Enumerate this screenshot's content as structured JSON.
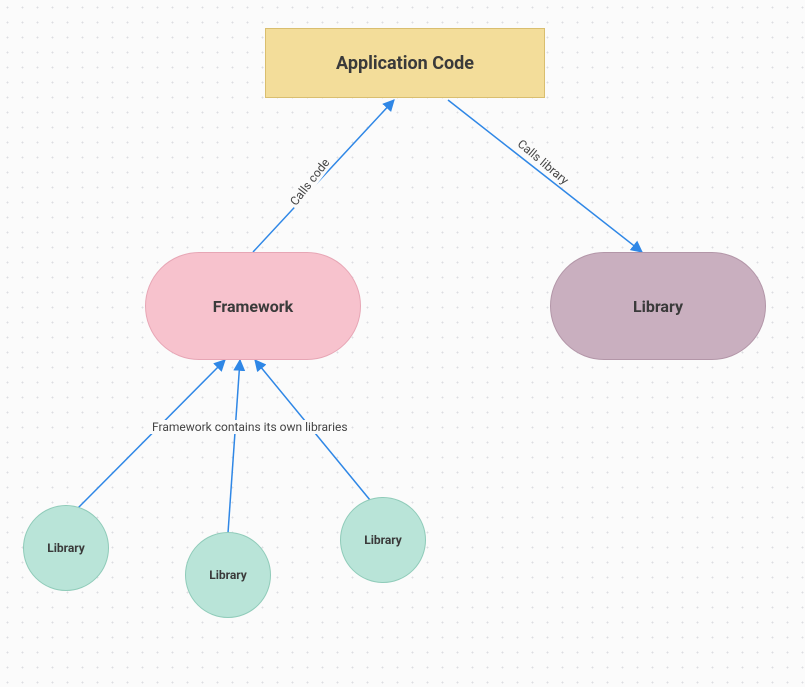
{
  "diagram": {
    "type": "flow",
    "nodes": {
      "application": {
        "label": "Application Code",
        "shape": "rectangle",
        "fill": "#f3dd9a"
      },
      "framework": {
        "label": "Framework",
        "shape": "rounded-rectangle",
        "fill": "#f7c2cd"
      },
      "library": {
        "label": "Library",
        "shape": "rounded-rectangle",
        "fill": "#c9afbf"
      },
      "lib_small_1": {
        "label": "Library",
        "shape": "circle",
        "fill": "#b9e4d8"
      },
      "lib_small_2": {
        "label": "Library",
        "shape": "circle",
        "fill": "#b9e4d8"
      },
      "lib_small_3": {
        "label": "Library",
        "shape": "circle",
        "fill": "#b9e4d8"
      }
    },
    "edges": {
      "framework_to_app": {
        "from": "framework",
        "to": "application",
        "label": "Calls code",
        "arrow_at": "to",
        "color": "#2f87e6"
      },
      "app_to_library": {
        "from": "application",
        "to": "library",
        "label": "Calls library",
        "arrow_at": "to",
        "color": "#2f87e6"
      },
      "framework_contains": {
        "from": "framework",
        "to": [
          "lib_small_1",
          "lib_small_2",
          "lib_small_3"
        ],
        "label": "Framework contains its own libraries",
        "arrow_at": "from",
        "color": "#2f87e6"
      }
    }
  }
}
